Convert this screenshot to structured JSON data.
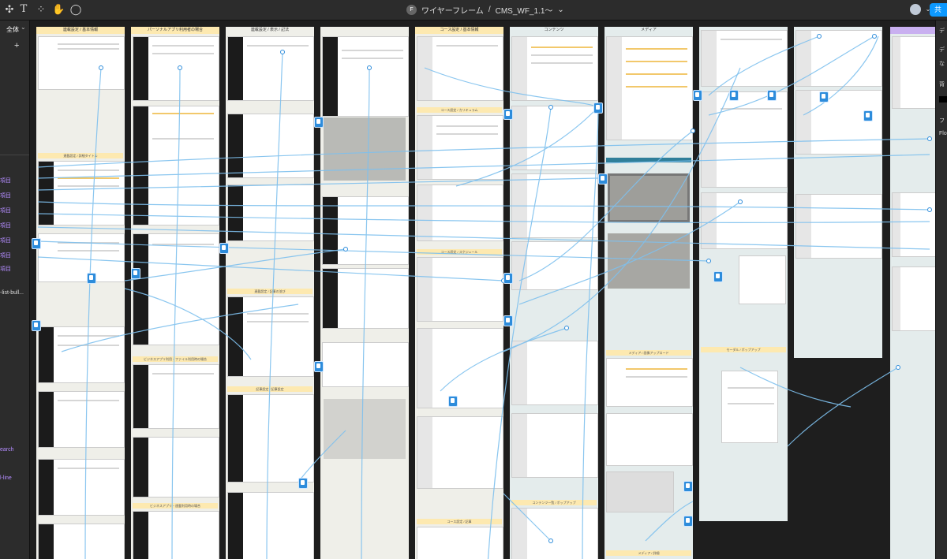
{
  "toolbar": {
    "doc_avatar_initial": "F",
    "project_name": "ワイヤーフレーム",
    "separator": "/",
    "file_name": "CMS_WF_1.1〜",
    "share_label": "共"
  },
  "left_panel": {
    "page_label": "全体",
    "add_label": "+",
    "layers": [
      "項目",
      "項目",
      "項目",
      "項目",
      "項目",
      "項目",
      "項目",
      "-list-bull...",
      "earch",
      "l-line"
    ]
  },
  "right_panel": {
    "items": [
      "デ",
      "デ",
      "な",
      "背",
      "フ",
      "Flo"
    ]
  },
  "sections": [
    {
      "title": "連載設定 / 基本情報",
      "banners": [
        "連載設定 / 詳細タイトル"
      ]
    },
    {
      "title": "パーソナルアプリ利用者の場合",
      "banners": [
        "ビジネスアプリ利用・ファイル利用時の場合",
        "ビジネスアプリ・連載利用時の場合"
      ]
    },
    {
      "title": "連載設定 / 表示 / 記法",
      "banners": [
        "連載設定 / 記事の並び",
        "記事設定 / 記事設定"
      ]
    },
    {
      "title": "",
      "banners": []
    },
    {
      "title": "コース設定 / 基本情報",
      "banners": [
        "コース設定 / カリキュラム",
        "コース設定 / スケジュール",
        "コース設定 / 記事"
      ]
    },
    {
      "title": "コンテンツ",
      "banners": [
        "コンテンツ一覧 / ポップアップ"
      ]
    },
    {
      "title": "メディア",
      "banners": [
        "メディア / 画像アップロード",
        "メディア / 詳細"
      ]
    },
    {
      "title": "",
      "banners": [
        "モーダル / ポップアップ"
      ]
    },
    {
      "title": "",
      "banners": []
    },
    {
      "title": "",
      "banners": []
    }
  ]
}
